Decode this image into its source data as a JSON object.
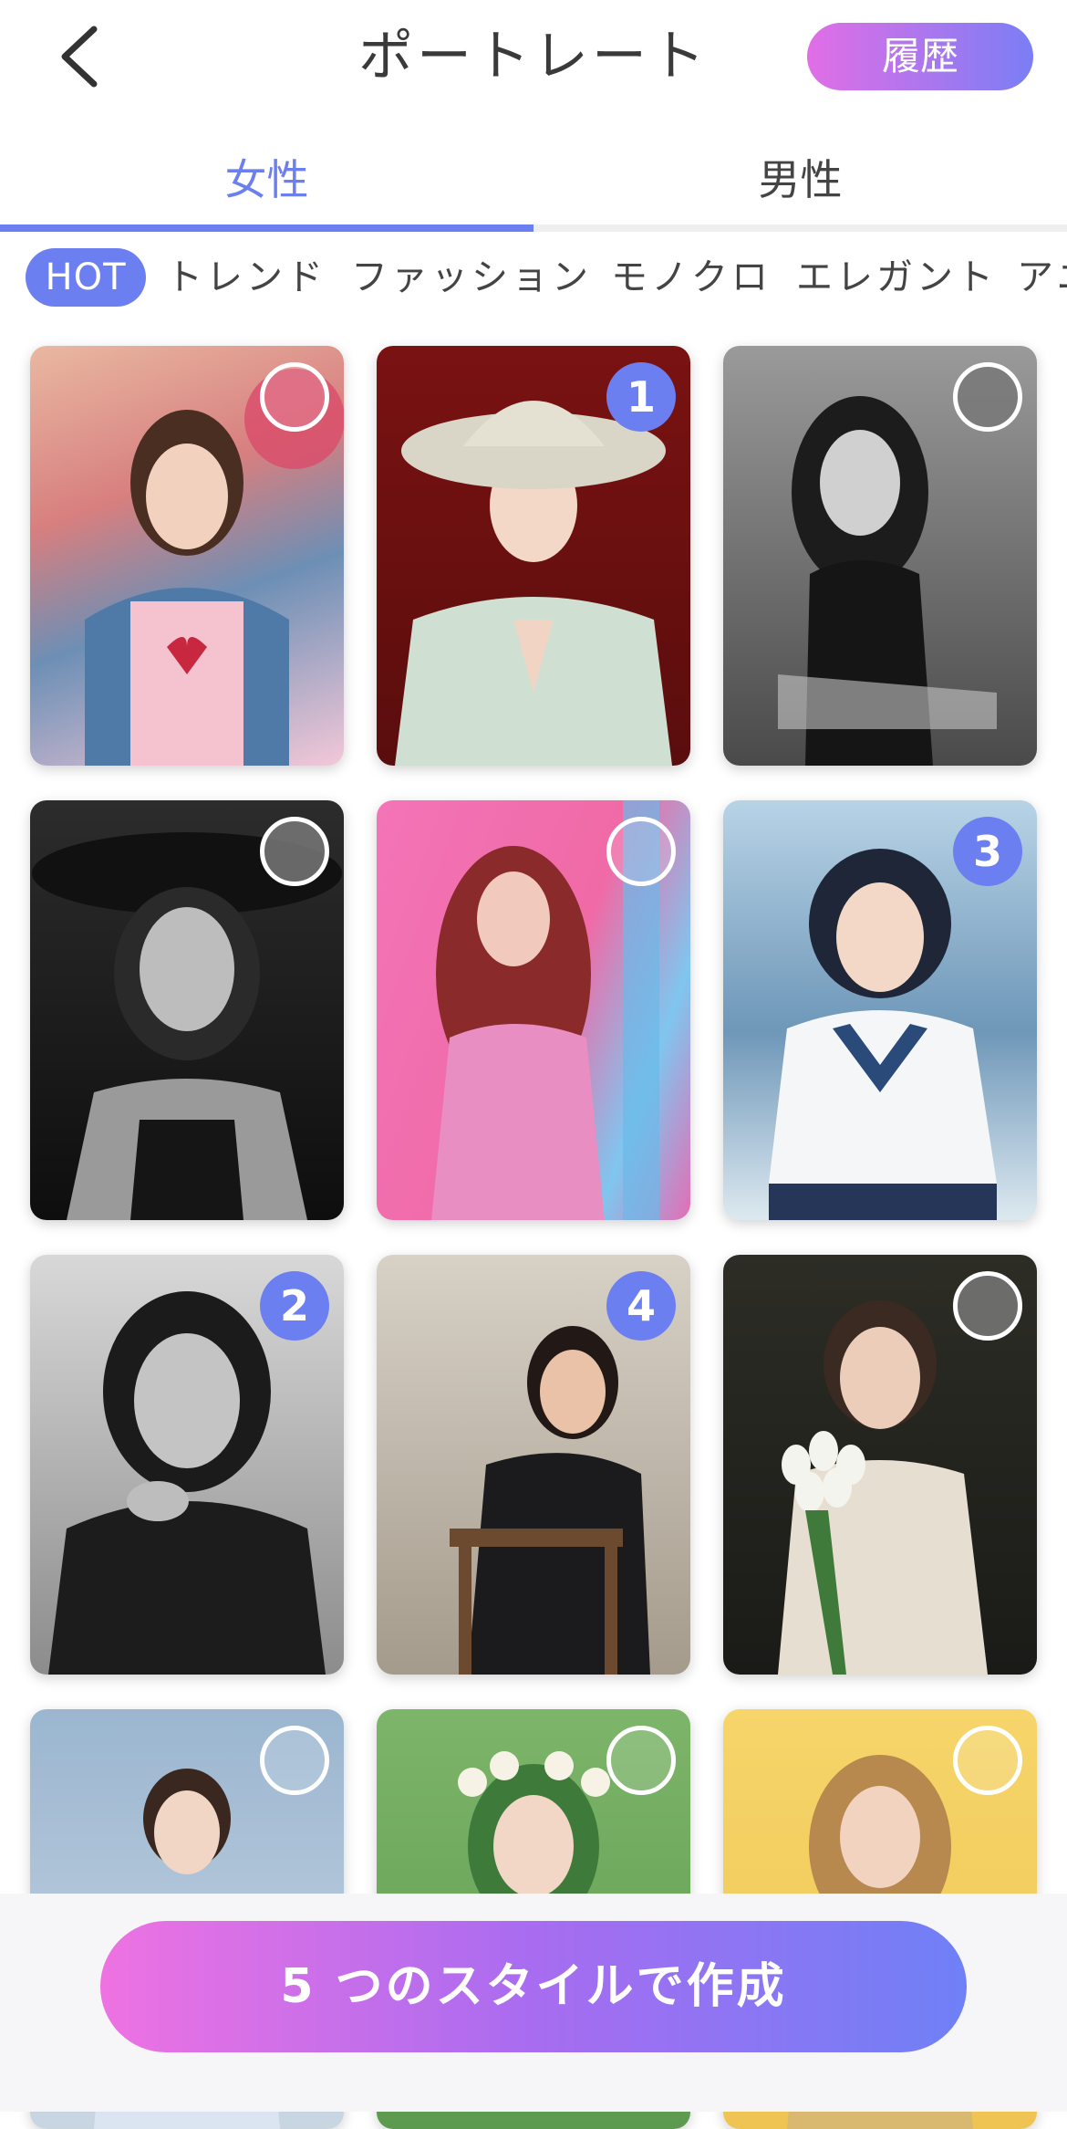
{
  "header": {
    "back_icon": "chevron-left-icon",
    "title": "ポートレート",
    "history_label": "履歴"
  },
  "gender_tabs": [
    {
      "label": "女性",
      "active": true
    },
    {
      "label": "男性",
      "active": false
    }
  ],
  "categories": [
    "HOT",
    "トレンド",
    "ファッション",
    "モノクロ",
    "エレガント",
    "アニ"
  ],
  "grid": [
    {
      "selection": ""
    },
    {
      "selection": "1"
    },
    {
      "selection": ""
    },
    {
      "selection": ""
    },
    {
      "selection": ""
    },
    {
      "selection": "3"
    },
    {
      "selection": "2"
    },
    {
      "selection": "4"
    },
    {
      "selection": ""
    },
    {
      "selection": ""
    },
    {
      "selection": ""
    },
    {
      "selection": ""
    }
  ],
  "create_button_label": "5 つのスタイルで作成",
  "colors": {
    "accent": "#6c7ff1",
    "gradient_start": "#ee72e2",
    "gradient_end": "#6f80f6"
  }
}
